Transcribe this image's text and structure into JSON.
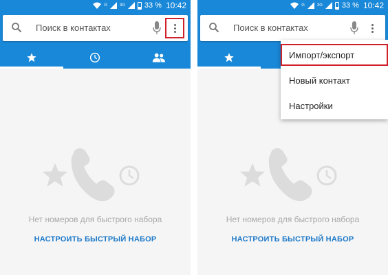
{
  "status_bar": {
    "network": "G",
    "network2": "3G",
    "battery": "33 %",
    "time": "10:42"
  },
  "search": {
    "placeholder": "Поиск в контактах"
  },
  "tabs": [
    {
      "icon": "star-icon",
      "active": true
    },
    {
      "icon": "clock-icon",
      "active": false
    },
    {
      "icon": "people-icon",
      "active": false
    }
  ],
  "empty_state": {
    "message": "Нет номеров для быстрого набора",
    "action": "НАСТРОИТЬ БЫСТРЫЙ НАБОР"
  },
  "overflow_menu": {
    "items": [
      "Импорт/экспорт",
      "Новый контакт",
      "Настройки"
    ]
  },
  "colors": {
    "primary": "#1a88d8",
    "highlight": "#d0202a",
    "link": "#1a78c8"
  }
}
